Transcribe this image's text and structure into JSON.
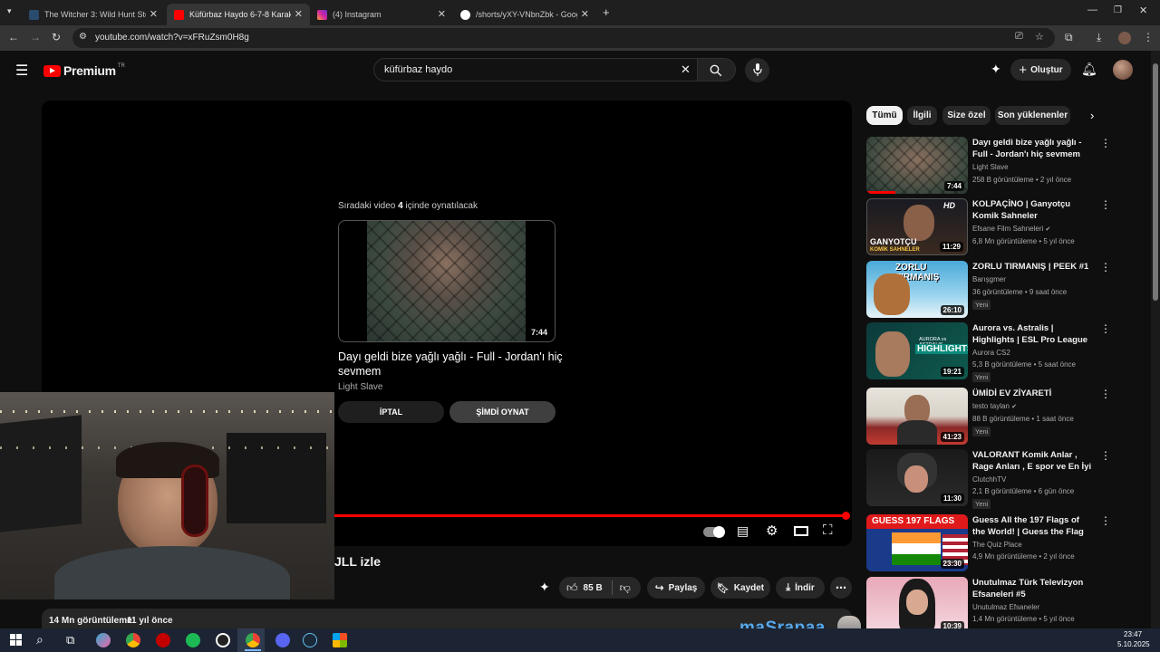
{
  "browser": {
    "tabs": [
      {
        "title": "The Witcher 3: Wild Hunt Steam"
      },
      {
        "title": "Küfürbaz Haydo 6-7-8 Karakol"
      },
      {
        "title": "(4) Instagram"
      },
      {
        "title": "/shorts/yXY-VNbnZbk - Google"
      }
    ],
    "new_tab": "+",
    "url": "youtube.com/watch?v=xFRuZsm0H8g"
  },
  "youtube": {
    "logo_text": "Premium",
    "logo_region": "TR",
    "search_value": "küfürbaz haydo",
    "create_label": "Oluştur"
  },
  "player": {
    "upnext_prefix": "Sıradaki video",
    "upnext_count": "4",
    "upnext_suffix": "içinde oynatılacak",
    "next_duration": "7:44",
    "next_title": "Dayı geldi bize yağlı yağlı - Full - Jordan'ı hiç sevmem",
    "next_channel": "Light Slave",
    "cancel_label": "İPTAL",
    "play_now_label": "ŞİMDİ OYNAT"
  },
  "video": {
    "title_fragment": "JLL izle",
    "like_count": "85 B",
    "share_label": "Paylaş",
    "save_label": "Kaydet",
    "download_label": "İndir",
    "views": "14 Mn görüntüleme",
    "age": "11 yıl önce"
  },
  "filters": [
    "Tümü",
    "İlgili",
    "Size özel",
    "Son yüklenenler"
  ],
  "recommendations": [
    {
      "title": "Dayı geldi bize yağlı yağlı - Full - Jordan'ı hiç sevmem",
      "channel": "Light Slave",
      "views": "258 B görüntüleme",
      "age": "2 yıl önce",
      "duration": "7:44",
      "new": "",
      "verified": false
    },
    {
      "title": "KOLPAÇİNO | Ganyotçu Komik Sahneler",
      "channel": "Efsane Film Sahneleri",
      "views": "6,8 Mn görüntüleme",
      "age": "5 yıl önce",
      "duration": "11:29",
      "new": "",
      "verified": true
    },
    {
      "title": "ZORLU TIRMANIŞ | PEEK #1",
      "channel": "Barışgmer",
      "views": "36 görüntüleme",
      "age": "9 saat önce",
      "duration": "26:10",
      "new": "Yeni",
      "verified": false
    },
    {
      "title": "Aurora vs. Astralis | Highlights | ESL Pro League Season 22",
      "channel": "Aurora CS2",
      "views": "5,3 B görüntüleme",
      "age": "5 saat önce",
      "duration": "19:21",
      "new": "Yeni",
      "verified": false
    },
    {
      "title": "ÜMİDİ EV ZİYARETİ",
      "channel": "testo taylan",
      "views": "88 B görüntüleme",
      "age": "1 saat önce",
      "duration": "41:23",
      "new": "Yeni",
      "verified": true
    },
    {
      "title": "VALORANT Komik Anlar , Rage Anları , E spor ve En İyi Vuruşl...",
      "channel": "ClutchhTV",
      "views": "2,1 B görüntüleme",
      "age": "6 gün önce",
      "duration": "11:30",
      "new": "Yeni",
      "verified": false
    },
    {
      "title": "Guess All the 197 Flags of the World! | Guess the Flag Quiz",
      "channel": "The Quiz Place",
      "views": "4,9 Mn görüntüleme",
      "age": "2 yıl önce",
      "duration": "23:30",
      "new": "",
      "verified": false
    },
    {
      "title": "Unutulmaz Türk Televizyon Efsaneleri #5",
      "channel": "Unutulmaz Efsaneler",
      "views": "1,4 Mn görüntüleme",
      "age": "5 yıl önce",
      "duration": "10:39",
      "new": "",
      "verified": false
    }
  ],
  "thumb_texts": {
    "r2": "GANYOTÇU",
    "r2b": "KOMİK SAHNELER",
    "r2hd": "HD",
    "r3": "ZORLU TIRMANIŞ",
    "r4": "HIGHLIGHTS",
    "r4b": "AURORA vs ASTRALIS",
    "r7": "GUESS 197 FLAGS"
  },
  "overlay": {
    "streamer_name": "maSrapaa"
  },
  "taskbar": {
    "time": "23:47",
    "date": "5.10.2025"
  },
  "colors": {
    "youtube_red": "#ff0000",
    "background": "#0f0f0f",
    "chip": "#272727"
  }
}
